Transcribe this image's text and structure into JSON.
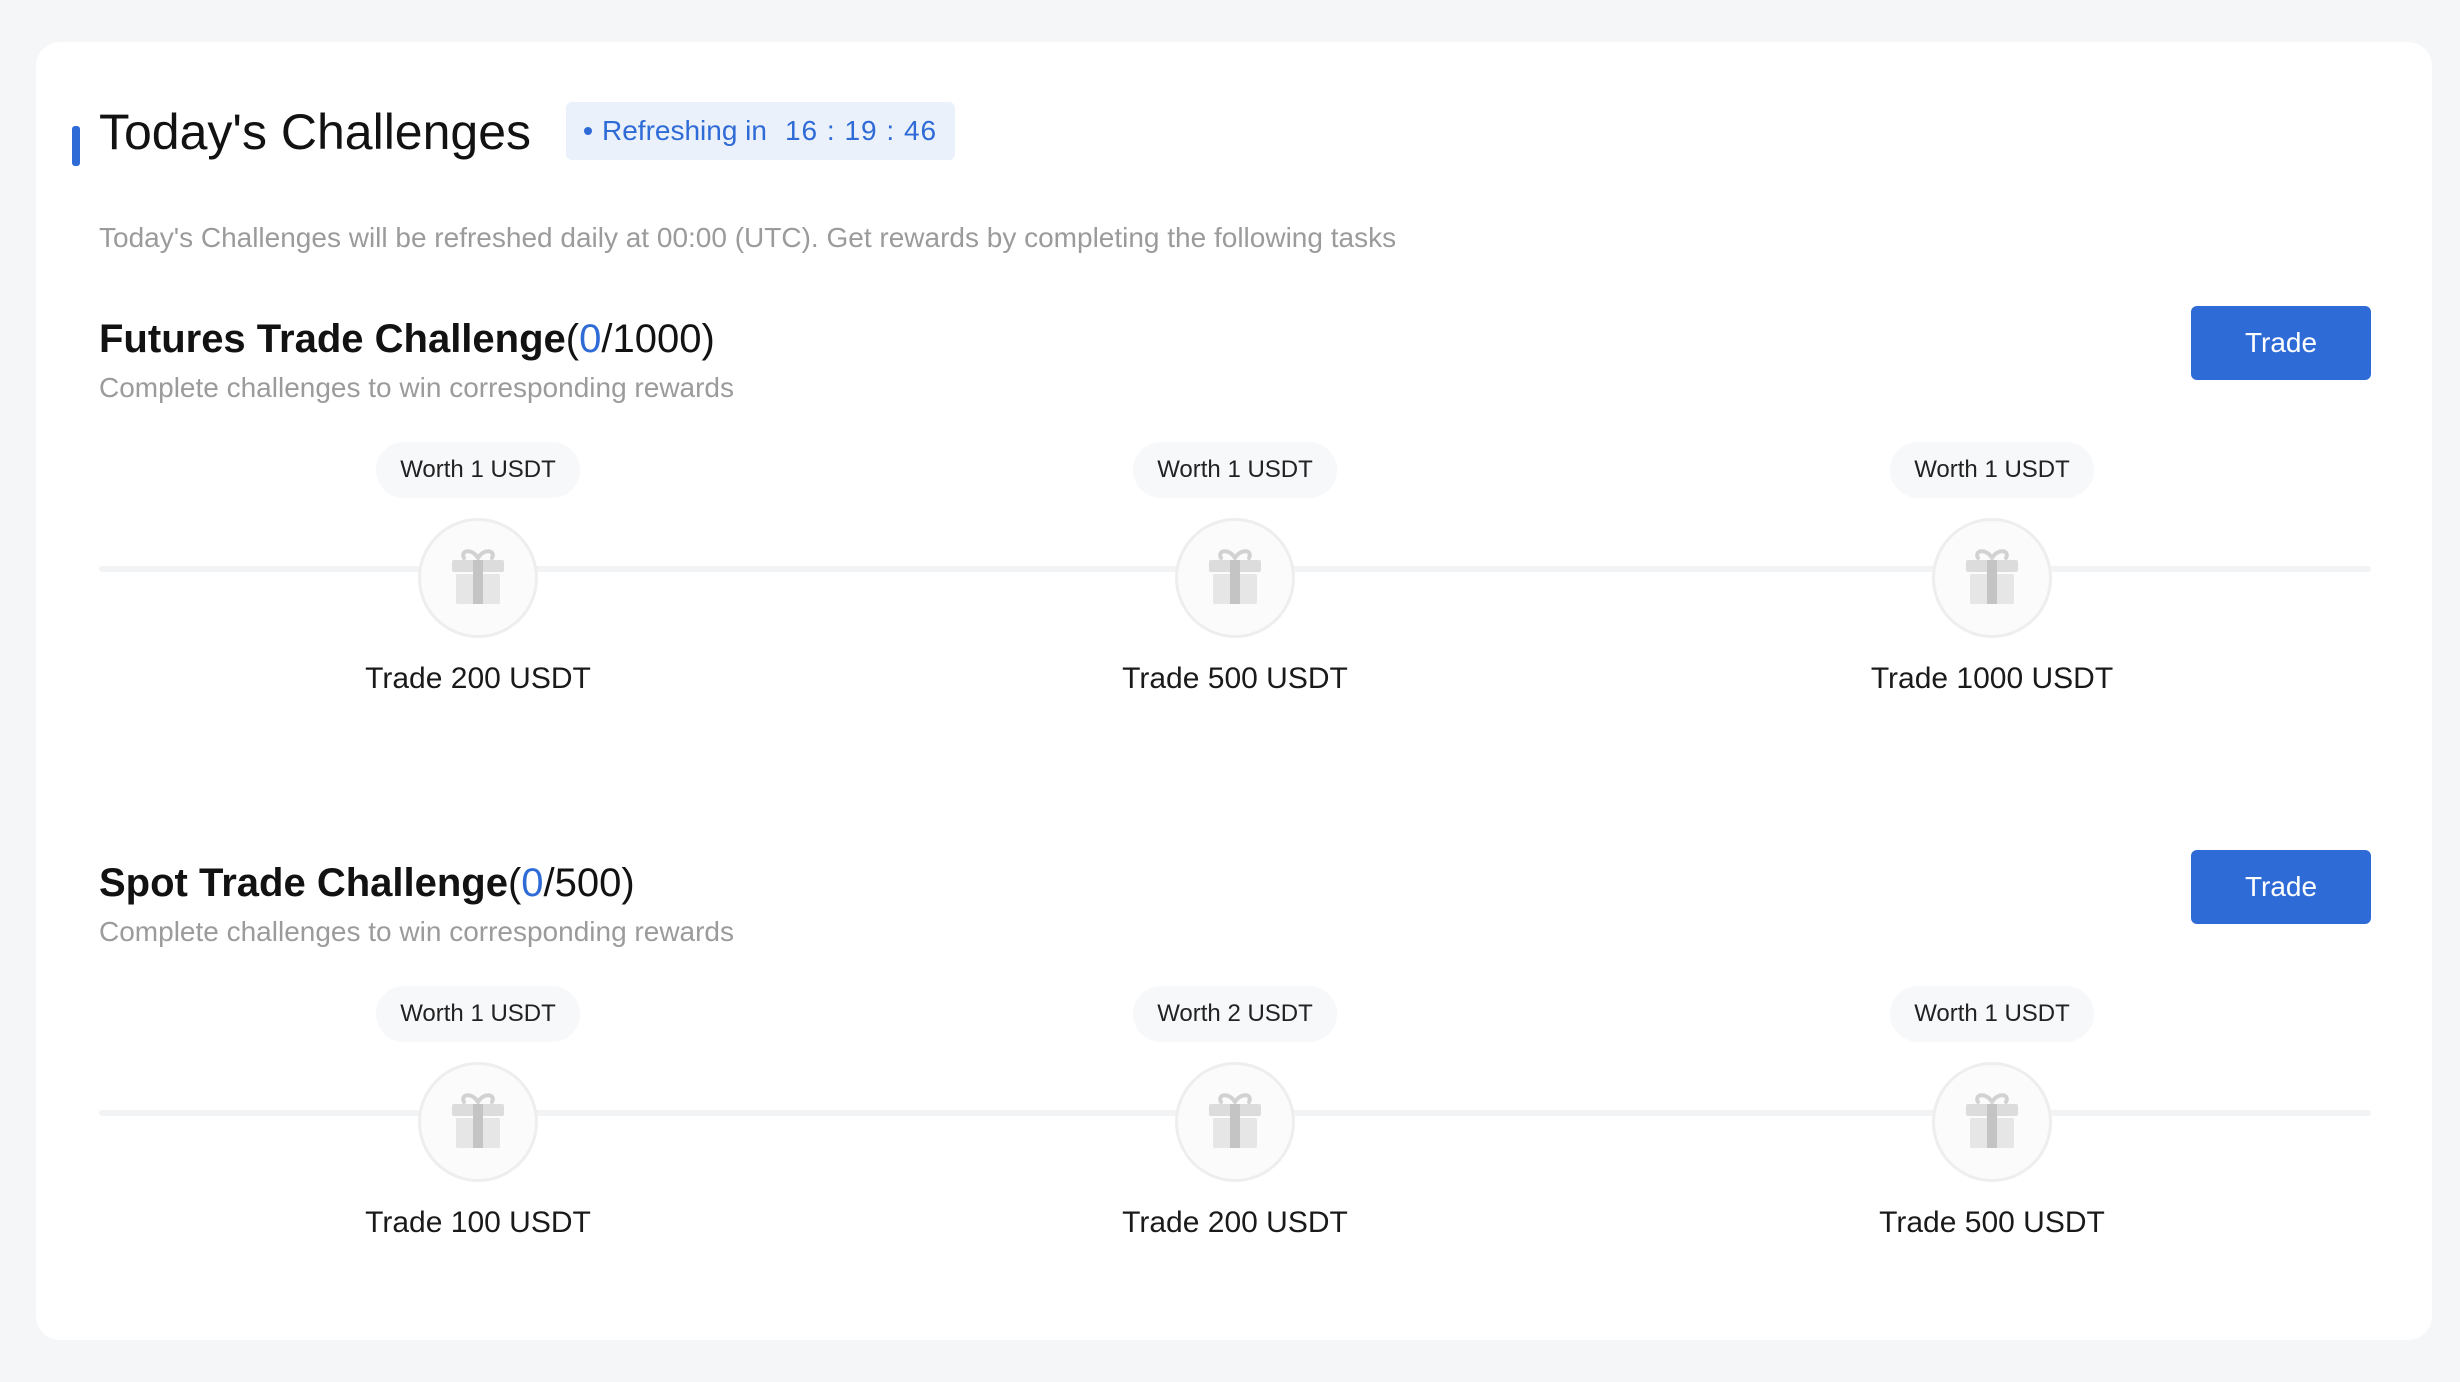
{
  "header": {
    "title": "Today's Challenges",
    "refresh_label": "Refreshing in",
    "refresh_time": "16 : 19 : 46",
    "subtitle": "Today's Challenges will be refreshed daily at 00:00 (UTC). Get rewards by completing the following tasks"
  },
  "sections": [
    {
      "name": "Futures Trade Challenge",
      "progress_open": "(",
      "progress_current": "0",
      "progress_total": "/1000)",
      "description": "Complete challenges to win corresponding rewards",
      "button_label": "Trade",
      "milestones": [
        {
          "reward": "Worth 1 USDT",
          "target": "Trade 200 USDT"
        },
        {
          "reward": "Worth 1 USDT",
          "target": "Trade 500 USDT"
        },
        {
          "reward": "Worth 1 USDT",
          "target": "Trade 1000 USDT"
        }
      ]
    },
    {
      "name": "Spot Trade Challenge",
      "progress_open": "(",
      "progress_current": "0",
      "progress_total": "/500)",
      "description": "Complete challenges to win corresponding rewards",
      "button_label": "Trade",
      "milestones": [
        {
          "reward": "Worth 1 USDT",
          "target": "Trade 100 USDT"
        },
        {
          "reward": "Worth 2 USDT",
          "target": "Trade 200 USDT"
        },
        {
          "reward": "Worth 1 USDT",
          "target": "Trade 500 USDT"
        }
      ]
    }
  ],
  "icons": {
    "milestone": "gift-icon"
  },
  "colors": {
    "accent": "#2f6bd6",
    "muted_text": "#9b9b9b",
    "badge_bg": "#eaf1fb"
  }
}
